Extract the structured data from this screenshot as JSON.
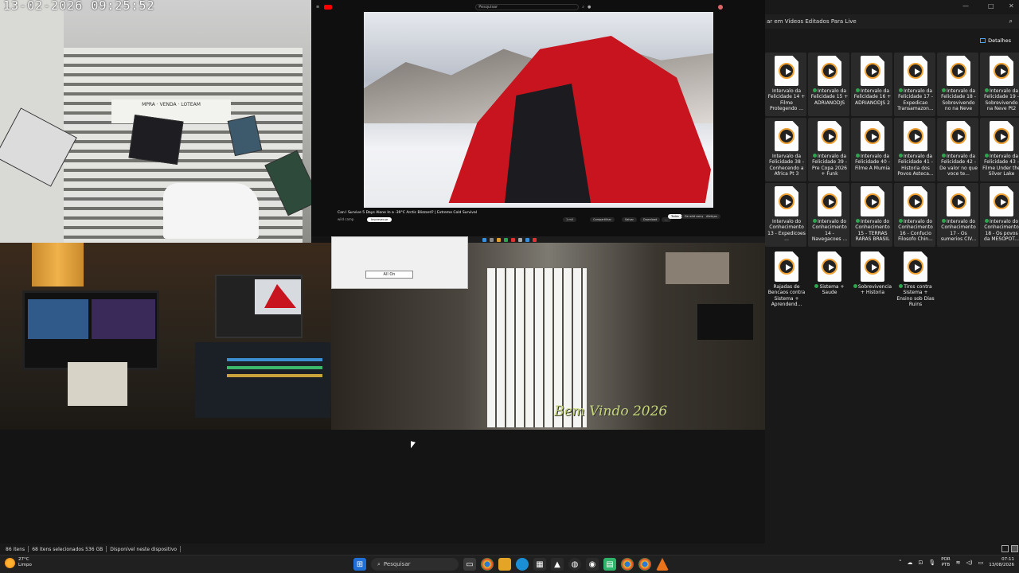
{
  "camera_top_left": {
    "timestamp": "13-02-2026  09:25:52",
    "sign_text": "MPRA · VENDA · LOTEAM"
  },
  "youtube": {
    "search_placeholder": "Pesquisar",
    "video_title": "Can I Survive 5 Days Alone In a -39°C Arctic Blizzard? | Extreme Cold Survival",
    "channel": "wild camp",
    "subscribe_label": "Inscrever-se",
    "actions": [
      "1 mil",
      "Compartilhar",
      "Salvar",
      "Download",
      "…"
    ],
    "chips": [
      "Todos",
      "De wild camp",
      "Afetiços"
    ],
    "accent_color": "#ff0000"
  },
  "camera_bottom_right": {
    "watermark": "Bem Vindo 2026",
    "dialog_button": "All On"
  },
  "explorer": {
    "search_text": "ar em Vídeos Editados Para Live",
    "details_label": "Detalhes",
    "window_controls": [
      "—",
      "□",
      "✕"
    ],
    "files": [
      {
        "label": "Intervalo da Felicidade 14 + Filme Protegendo ...",
        "synced": false
      },
      {
        "label": "Intervalo da Felicidade 15 + ADRIANODJS",
        "synced": true
      },
      {
        "label": "Intervalo da Felicidade 16 + ADRIANODJS 2",
        "synced": true
      },
      {
        "label": "Intervalo da Felicidade 17 - Expedicao Transamazon...",
        "synced": true
      },
      {
        "label": "Intervalo da Felicidade 18 - Sobrevivendo no na Neve",
        "synced": true
      },
      {
        "label": "Intervalo da Felicidade 19 - Sobrevivendo na Neve Pt2",
        "synced": true
      },
      {
        "label": "Intervalo da Felicidade 38 - Conhecendo a Africa Pt 3",
        "synced": false
      },
      {
        "label": "Intervalo da Felicidade 39 - Pre Copa 2026 + Funk",
        "synced": true
      },
      {
        "label": "Intervalo da Felicidade 40 - Filme A Mumia",
        "synced": true
      },
      {
        "label": "Intervalo da Felicidade 41 - Historia dos Povos Asteca...",
        "synced": true
      },
      {
        "label": "Intervalo da Felicidade 42 - De valor no que voce te...",
        "synced": true
      },
      {
        "label": "Intervalo da Felicidade 43 - Filme Under the Silver Lake",
        "synced": true
      },
      {
        "label": "Intervalo do Conhecimento 13 - Expedicoes ...",
        "synced": false
      },
      {
        "label": "Intervalo do Conhecimento 14 - Navegacoes ...",
        "synced": true
      },
      {
        "label": "Intervalo do Conhecimento 15 - TERRAS RARAS BRASIL",
        "synced": true
      },
      {
        "label": "Intervalo do Conhecimento 16 - Confucio Filosofo Chin...",
        "synced": true
      },
      {
        "label": "Intervalo do Conhecimento 17 - Os sumerios CIV...",
        "synced": true
      },
      {
        "label": "Intervalo do Conhecimento 18 - Os povos da MESOPOT...",
        "synced": true
      },
      {
        "label": "Rajadas de Bencaos contra Sistema + Aprendend...",
        "synced": false
      },
      {
        "label": "Sistema + Saude",
        "synced": true
      },
      {
        "label": "Sobrevivencia + Historia",
        "synced": true
      },
      {
        "label": "Tiros contra Sistema + Ensino sob Dias Ruins",
        "synced": true
      }
    ]
  },
  "statusbar": {
    "items_count": "86 itens",
    "selected": "68 itens selecionados  536 GB",
    "availability": "Disponível neste dispositivo"
  },
  "taskbar": {
    "temperature": "27°C",
    "weather": "Limpo",
    "search_placeholder": "Pesquisar",
    "language_top": "POR",
    "language_bottom": "PTB",
    "time": "07:11",
    "date": "13/08/2026"
  }
}
